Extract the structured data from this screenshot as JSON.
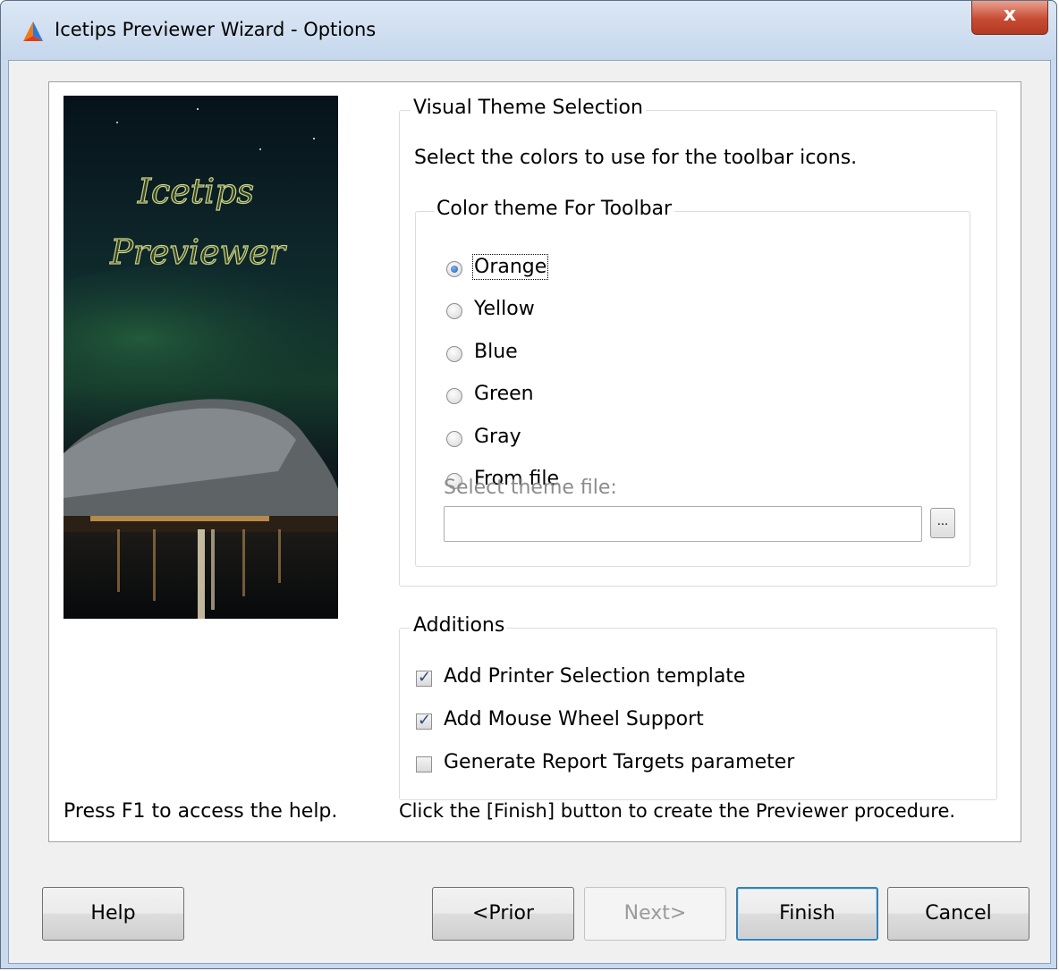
{
  "window": {
    "title": "Icetips Previewer Wizard - Options",
    "close_label": "x"
  },
  "image": {
    "line1": "Icetips",
    "line2": "Previewer"
  },
  "visual_theme": {
    "legend": "Visual Theme Selection",
    "description": "Select the colors to use for the toolbar icons.",
    "color_group": {
      "legend": "Color theme For Toolbar",
      "options": [
        "Orange",
        "Yellow",
        "Blue",
        "Green",
        "Gray",
        "From file"
      ],
      "selected": "Orange",
      "theme_file_label": "Select theme file:",
      "theme_file_value": "",
      "browse_label": "..."
    }
  },
  "additions": {
    "legend": "Additions",
    "items": [
      {
        "label": "Add Printer Selection template",
        "checked": true
      },
      {
        "label": "Add Mouse Wheel Support",
        "checked": true
      },
      {
        "label": "Generate Report Targets parameter",
        "checked": false
      }
    ]
  },
  "help_hint": "Press F1 to access the help.",
  "finish_hint": "Click the [Finish] button to create the Previewer procedure.",
  "buttons": {
    "help": "Help",
    "prior": "<Prior",
    "next": "Next>",
    "finish": "Finish",
    "cancel": "Cancel"
  }
}
